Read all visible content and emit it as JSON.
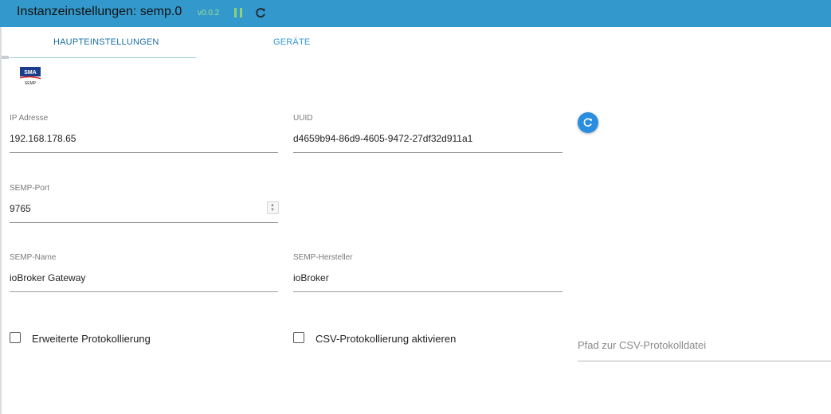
{
  "header": {
    "title": "Instanzeinstellungen: semp.0",
    "version": "v0.0.2",
    "accent_color": "#3399cc"
  },
  "tabs": [
    {
      "label": "HAUPTEINSTELLUNGEN",
      "active": true
    },
    {
      "label": "GERÄTE",
      "active": false
    }
  ],
  "logo": {
    "text_top": "SMA",
    "text_bottom": "SEMP"
  },
  "form": {
    "ip": {
      "label": "IP Adresse",
      "value": "192.168.178.65"
    },
    "uuid": {
      "label": "UUID",
      "value": "d4659b94-86d9-4605-9472-27df32d911a1"
    },
    "port": {
      "label": "SEMP-Port",
      "value": "9765"
    },
    "name": {
      "label": "SEMP-Name",
      "value": "ioBroker Gateway"
    },
    "manufacturer": {
      "label": "SEMP-Hersteller",
      "value": "ioBroker"
    },
    "extended_logging": {
      "label": "Erweiterte Protokollierung",
      "checked": false
    },
    "csv_logging": {
      "label": "CSV-Protokollierung aktivieren",
      "checked": false
    },
    "csv_path": {
      "placeholder": "Pfad zur CSV-Protokolldatei",
      "value": ""
    }
  },
  "icons": {
    "pause": "pause-icon",
    "reload": "reload-icon",
    "regenerate_uuid": "refresh-icon"
  }
}
